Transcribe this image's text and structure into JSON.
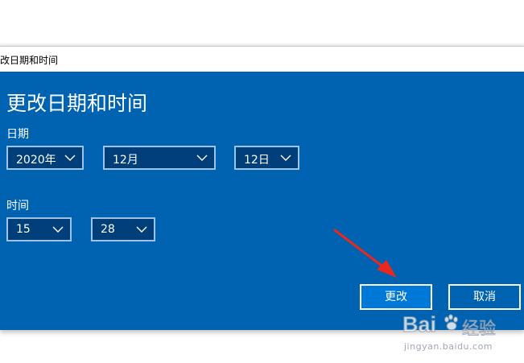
{
  "window": {
    "title": "改日期和时间"
  },
  "dialog": {
    "heading": "更改日期和时间",
    "date_label": "日期",
    "time_label": "时间",
    "year": "2020年",
    "month": "12月",
    "day": "12日",
    "hour": "15",
    "minute": "28",
    "change_button": "更改",
    "cancel_button": "取消"
  },
  "watermark": {
    "brand_a": "Bai",
    "brand_b": "经验",
    "url": "jingyan.baidu.com"
  },
  "colors": {
    "background": "#0063b1",
    "dropdown_bg": "#003f7a",
    "primary_button": "#0078d7",
    "arrow": "#e8281e"
  }
}
